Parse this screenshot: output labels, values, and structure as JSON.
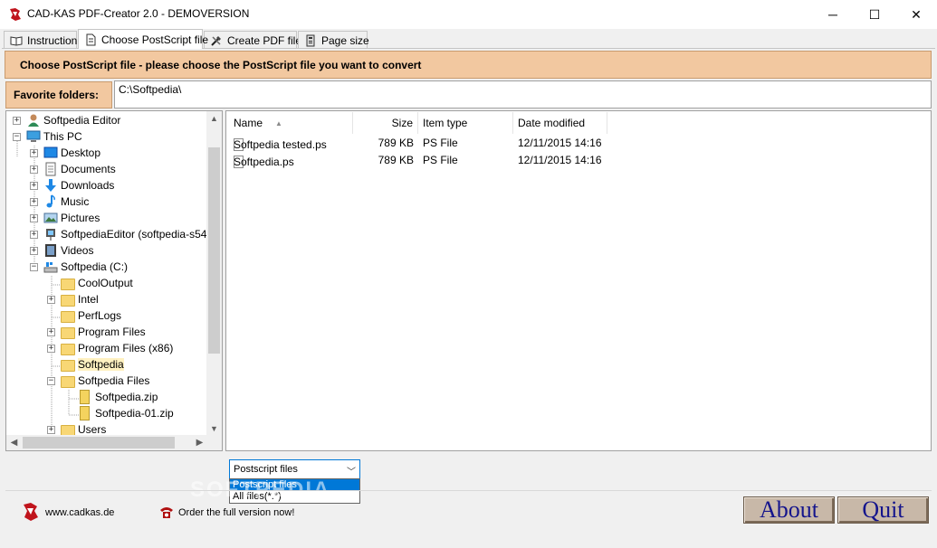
{
  "window": {
    "title": "CAD-KAS PDF-Creator 2.0 - DEMOVERSION",
    "minimize": "─",
    "maximize": "☐",
    "close": "✕"
  },
  "tabs": [
    {
      "label": "Instruction",
      "icon": "book-icon",
      "active": false
    },
    {
      "label": "Choose PostScript file",
      "icon": "document-icon",
      "active": true
    },
    {
      "label": "Create PDF file",
      "icon": "tools-icon",
      "active": false
    },
    {
      "label": "Page size",
      "icon": "page-size-icon",
      "active": false
    }
  ],
  "header": {
    "text": "Choose PostScript file - please choose the PostScript file you want to convert"
  },
  "favorites": {
    "label": "Favorite folders:",
    "value": "C:\\Softpedia\\"
  },
  "tree": {
    "items": [
      {
        "label": "Softpedia Editor",
        "icon": "user-icon",
        "expander": "+"
      },
      {
        "label": "This PC",
        "icon": "computer-icon",
        "expander": "−"
      },
      {
        "label": "Desktop",
        "icon": "desktop-icon",
        "expander": "+"
      },
      {
        "label": "Documents",
        "icon": "documents-icon",
        "expander": "+"
      },
      {
        "label": "Downloads",
        "icon": "download-icon",
        "expander": "+"
      },
      {
        "label": "Music",
        "icon": "music-icon",
        "expander": "+"
      },
      {
        "label": "Pictures",
        "icon": "pictures-icon",
        "expander": "+"
      },
      {
        "label": "SoftpediaEditor (softpedia-s54",
        "icon": "network-drive-icon",
        "expander": "+"
      },
      {
        "label": "Videos",
        "icon": "videos-icon",
        "expander": "+"
      },
      {
        "label": "Softpedia (C:)",
        "icon": "drive-icon",
        "expander": "−"
      },
      {
        "label": "CoolOutput",
        "icon": "folder-icon",
        "expander": ""
      },
      {
        "label": "Intel",
        "icon": "folder-icon",
        "expander": "+"
      },
      {
        "label": "PerfLogs",
        "icon": "folder-icon",
        "expander": ""
      },
      {
        "label": "Program Files",
        "icon": "folder-icon",
        "expander": "+"
      },
      {
        "label": "Program Files (x86)",
        "icon": "folder-icon",
        "expander": "+"
      },
      {
        "label": "Softpedia",
        "icon": "folder-icon",
        "expander": ""
      },
      {
        "label": "Softpedia Files",
        "icon": "folder-icon",
        "expander": "−"
      },
      {
        "label": "Softpedia.zip",
        "icon": "zip-icon",
        "expander": ""
      },
      {
        "label": "Softpedia-01.zip",
        "icon": "zip-icon",
        "expander": ""
      },
      {
        "label": "Users",
        "icon": "folder-icon",
        "expander": "+"
      }
    ],
    "selected": "Softpedia"
  },
  "filelist": {
    "columns": {
      "name": "Name",
      "size": "Size",
      "type": "Item type",
      "date": "Date modified"
    },
    "rows": [
      {
        "name": "Softpedia tested.ps",
        "size": "789 KB",
        "type": "PS File",
        "date": "12/11/2015 14:16"
      },
      {
        "name": "Softpedia.ps",
        "size": "789 KB",
        "type": "PS File",
        "date": "12/11/2015 14:16"
      }
    ]
  },
  "filter": {
    "selected": "Postscript files",
    "options": [
      "Postscript files",
      "All files(*.*)"
    ]
  },
  "footer": {
    "url": "www.cadkas.de",
    "order": "Order the full version now!",
    "about": "About",
    "quit": "Quit"
  },
  "watermark": "SOFTPEDIA",
  "colors": {
    "header_bg": "#f2c8a0",
    "button_text": "#14148c",
    "selection": "#0078d7"
  }
}
